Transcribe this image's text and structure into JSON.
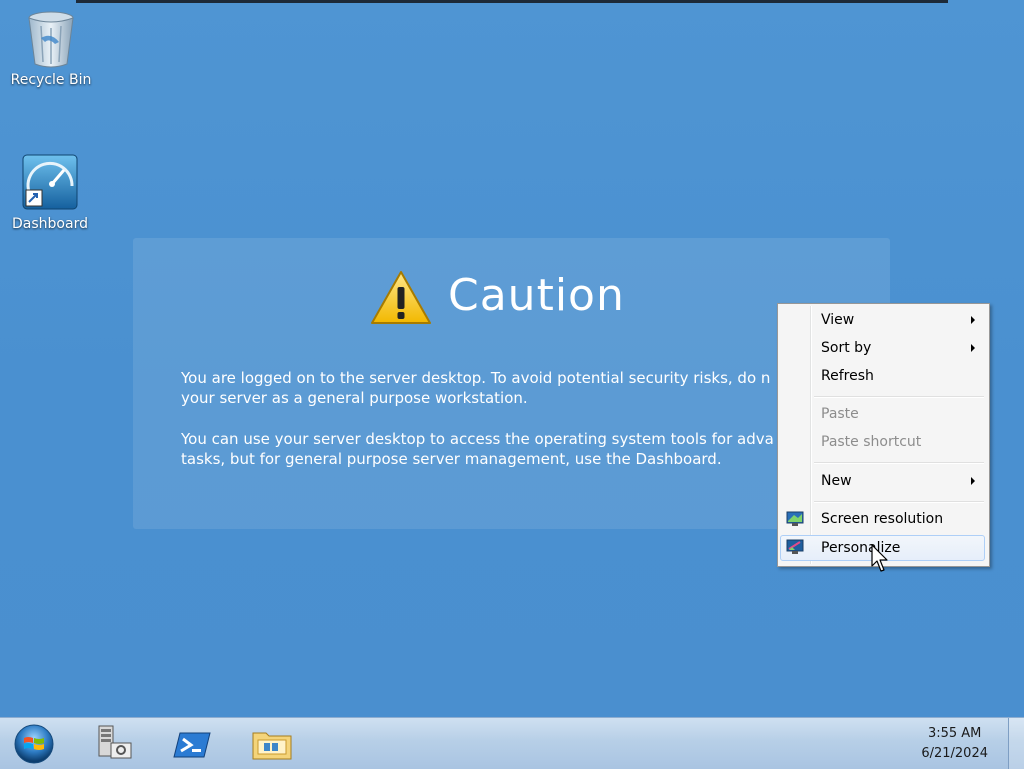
{
  "desktop": {
    "icons": [
      {
        "label": "Recycle Bin",
        "icon": "recycle-bin-icon"
      },
      {
        "label": "Dashboard",
        "icon": "dashboard-icon"
      }
    ]
  },
  "caution": {
    "title": "Caution",
    "icon": "warning-icon",
    "paragraph1_line1": "You are logged on to the server desktop. To avoid potential security risks, do n",
    "paragraph1_line2": "your server as a general purpose workstation.",
    "paragraph2_line1": "You can use your server desktop to access the operating system tools for adva",
    "paragraph2_line2": "tasks, but for general purpose server management, use the Dashboard."
  },
  "context_menu": {
    "items": [
      {
        "label": "View",
        "submenu": true
      },
      {
        "label": "Sort by",
        "submenu": true
      },
      {
        "label": "Refresh"
      },
      {
        "label": "Paste",
        "disabled": true
      },
      {
        "label": "Paste shortcut",
        "disabled": true
      },
      {
        "label": "New",
        "submenu": true
      },
      {
        "label": "Screen resolution",
        "icon": "screen-resolution-icon"
      },
      {
        "label": "Personalize",
        "icon": "personalize-icon",
        "highlighted": true
      }
    ]
  },
  "taskbar": {
    "start_icon": "windows-start-orb-icon",
    "pinned": [
      {
        "icon": "server-manager-icon"
      },
      {
        "icon": "powershell-icon"
      },
      {
        "icon": "file-explorer-icon"
      }
    ],
    "time": "3:55 AM",
    "date": "6/21/2024"
  },
  "colors": {
    "desktop_bg": "#4a8fcf",
    "taskbar_bg": "#b7cfe7",
    "menu_bg": "#f5f5f5",
    "highlight_border": "#aecff7"
  }
}
